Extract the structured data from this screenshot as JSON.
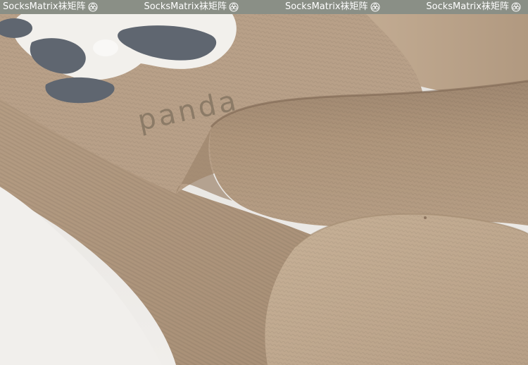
{
  "watermark": {
    "text": "SocksMatrix袜矩阵",
    "repeats": [
      "SocksMatrix袜矩阵",
      "SocksMatrix袜矩阵",
      "SocksMatrix袜矩阵",
      "SocksMatrix袜矩阵"
    ],
    "icon": "flower-badge-icon",
    "banner_color": "#8a8f86"
  },
  "photo": {
    "subject": "beige knit socks with panda motif",
    "printed_word": "panda",
    "colors": {
      "sock": "#b39a80",
      "sock_shadow": "#8e7660",
      "sock_light": "#cbb59c",
      "panda_white": "#f2f0ec",
      "panda_grey": "#5f6670",
      "surface": "#ebe8e4"
    }
  }
}
